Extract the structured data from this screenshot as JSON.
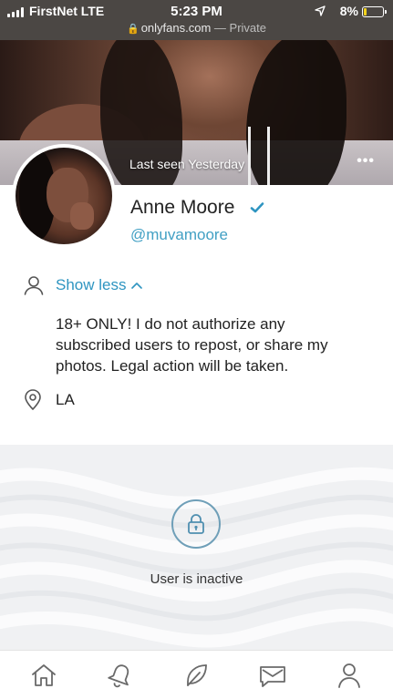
{
  "status_bar": {
    "carrier": "FirstNet LTE",
    "time": "5:23 PM",
    "battery_percent": "8%",
    "battery_level": 0.08
  },
  "url_bar": {
    "domain": "onlyfans.com",
    "separator": " — ",
    "mode": "Private"
  },
  "cover": {
    "last_seen": "Last seen Yesterday",
    "more_icon": "ellipsis-icon"
  },
  "profile": {
    "name": "Anne Moore",
    "handle": "@muvamoore",
    "verified": true,
    "show_less_label": "Show less",
    "bio": "18+ ONLY! I do not authorize any subscribed users to repost, or share my photos. Legal action will be taken.",
    "location": "LA"
  },
  "inactive": {
    "icon": "lock-icon",
    "message": "User is inactive"
  },
  "nav": {
    "items": [
      {
        "icon": "home-icon"
      },
      {
        "icon": "bell-icon"
      },
      {
        "icon": "feather-icon"
      },
      {
        "icon": "message-icon"
      },
      {
        "icon": "profile-icon"
      }
    ]
  },
  "colors": {
    "accent": "#2f95c1",
    "handle": "#42a0c4",
    "status_bar": "#4b4744",
    "battery_low": "#f2d21b",
    "panel_bg": "#f0f1f3"
  }
}
